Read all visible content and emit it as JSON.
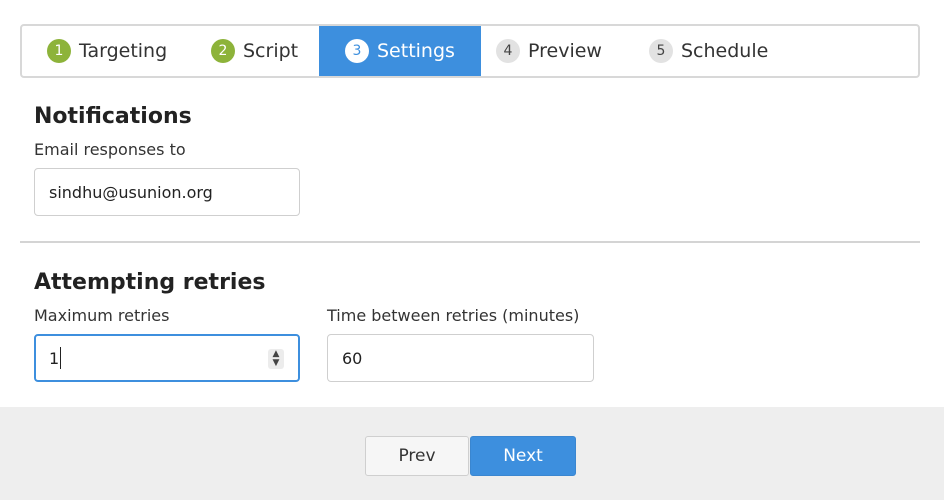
{
  "steps": [
    {
      "num": "1",
      "label": "Targeting",
      "state": "done"
    },
    {
      "num": "2",
      "label": "Script",
      "state": "done"
    },
    {
      "num": "3",
      "label": "Settings",
      "state": "active"
    },
    {
      "num": "4",
      "label": "Preview",
      "state": "todo"
    },
    {
      "num": "5",
      "label": "Schedule",
      "state": "todo"
    }
  ],
  "notifications": {
    "heading": "Notifications",
    "email_label": "Email responses to",
    "email_value": "sindhu@usunion.org"
  },
  "retries": {
    "heading": "Attempting retries",
    "max_label": "Maximum retries",
    "max_value": "1",
    "time_label": "Time between retries (minutes)",
    "time_value": "60"
  },
  "footer": {
    "prev_label": "Prev",
    "next_label": "Next"
  },
  "colors": {
    "accent": "#3d8fde",
    "done": "#8db33a",
    "todo": "#e2e2e2"
  }
}
